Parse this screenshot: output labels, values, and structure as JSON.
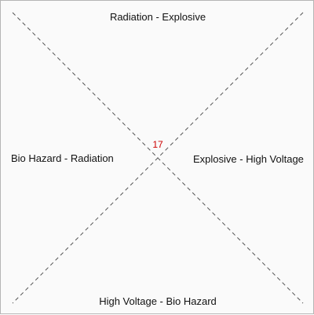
{
  "quadrants": {
    "top": "Radiation - Explosive",
    "right": "Explosive - High Voltage",
    "bottom": "High Voltage - Bio Hazard",
    "left": "Bio Hazard - Radiation"
  },
  "center_value": "17",
  "colors": {
    "background": "#fafafa",
    "border": "#b5b5b5",
    "diagonal": "#555555",
    "text": "#111111",
    "center_value": "#cc0000"
  }
}
